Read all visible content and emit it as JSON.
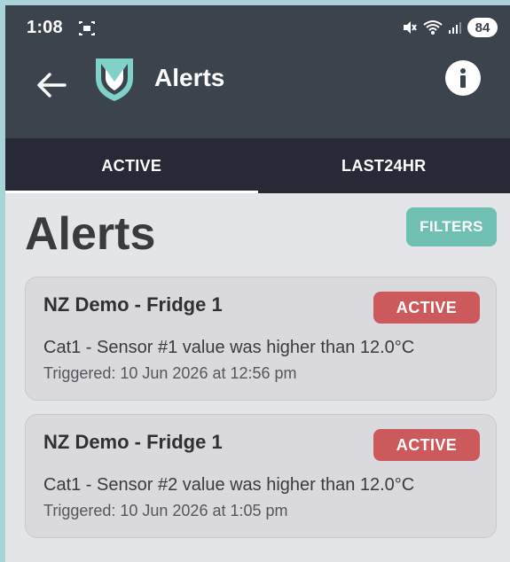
{
  "status_bar": {
    "time": "1:08",
    "battery": "84",
    "icons": [
      "screen-cast-icon",
      "mute-icon",
      "wifi-icon",
      "signal-icon",
      "battery-icon"
    ]
  },
  "app_bar": {
    "title": "Alerts",
    "icons": [
      "back-arrow-icon",
      "logo-shield-icon",
      "info-icon"
    ]
  },
  "tabs": [
    {
      "label": "ACTIVE",
      "selected": true
    },
    {
      "label": "LAST24HR",
      "selected": false
    }
  ],
  "page": {
    "title": "Alerts",
    "filters_label": "FILTERS"
  },
  "alerts": [
    {
      "title": "NZ Demo - Fridge 1",
      "status": "ACTIVE",
      "message": "Cat1 - Sensor #1 value was higher than 12.0°C",
      "triggered": "Triggered: 10 Jun 2026 at 12:56 pm"
    },
    {
      "title": "NZ Demo - Fridge 1",
      "status": "ACTIVE",
      "message": "Cat1 - Sensor #2 value was higher than 12.0°C",
      "triggered": "Triggered: 10 Jun 2026 at 1:05 pm"
    }
  ],
  "colors": {
    "header": "#3b434d",
    "tab_bar": "#272937",
    "filters": "#6fbfb3",
    "badge": "#cc5a5d",
    "logo_teal": "#7fd1c9"
  }
}
